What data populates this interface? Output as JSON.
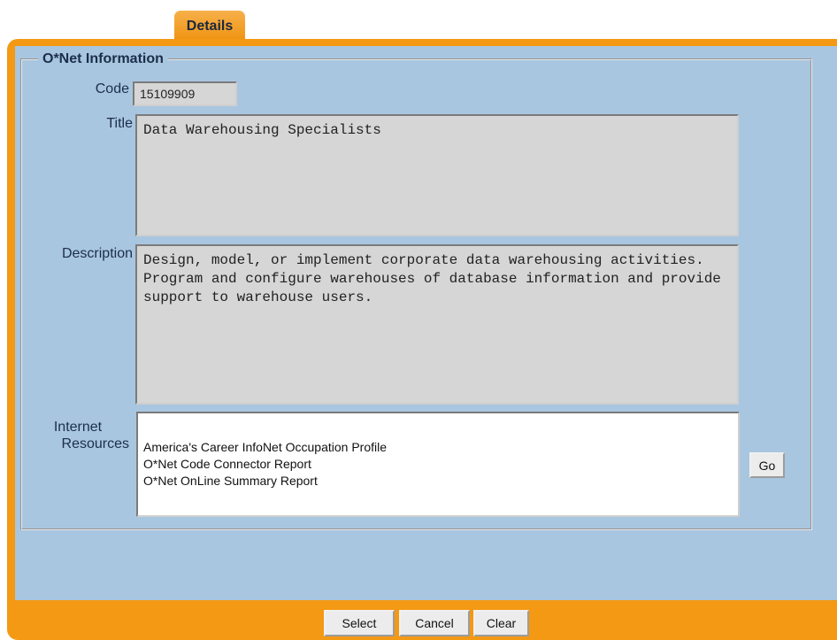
{
  "tabs": [
    {
      "label": "Details",
      "active": true
    }
  ],
  "group": {
    "legend": "O*Net Information"
  },
  "fields": {
    "code": {
      "label": "Code",
      "value": "15109909"
    },
    "title": {
      "label": "Title",
      "value": "Data Warehousing Specialists"
    },
    "description": {
      "label": "Description",
      "value": "Design, model, or implement corporate data warehousing activities. Program and configure warehouses of database information and provide support to warehouse users."
    },
    "internet_resources": {
      "label_line1": "Internet",
      "label_line2": "Resources",
      "options": [
        "America's Career InfoNet Occupation Profile",
        "O*Net Code Connector Report",
        "O*Net OnLine Summary Report"
      ],
      "go_label": "Go"
    }
  },
  "footer": {
    "select_label": "Select",
    "cancel_label": "Cancel",
    "clear_label": "Clear"
  },
  "colors": {
    "accent_orange": "#f39913",
    "panel_blue": "#a9c6e0",
    "readonly_gray": "#d6d6d6"
  }
}
